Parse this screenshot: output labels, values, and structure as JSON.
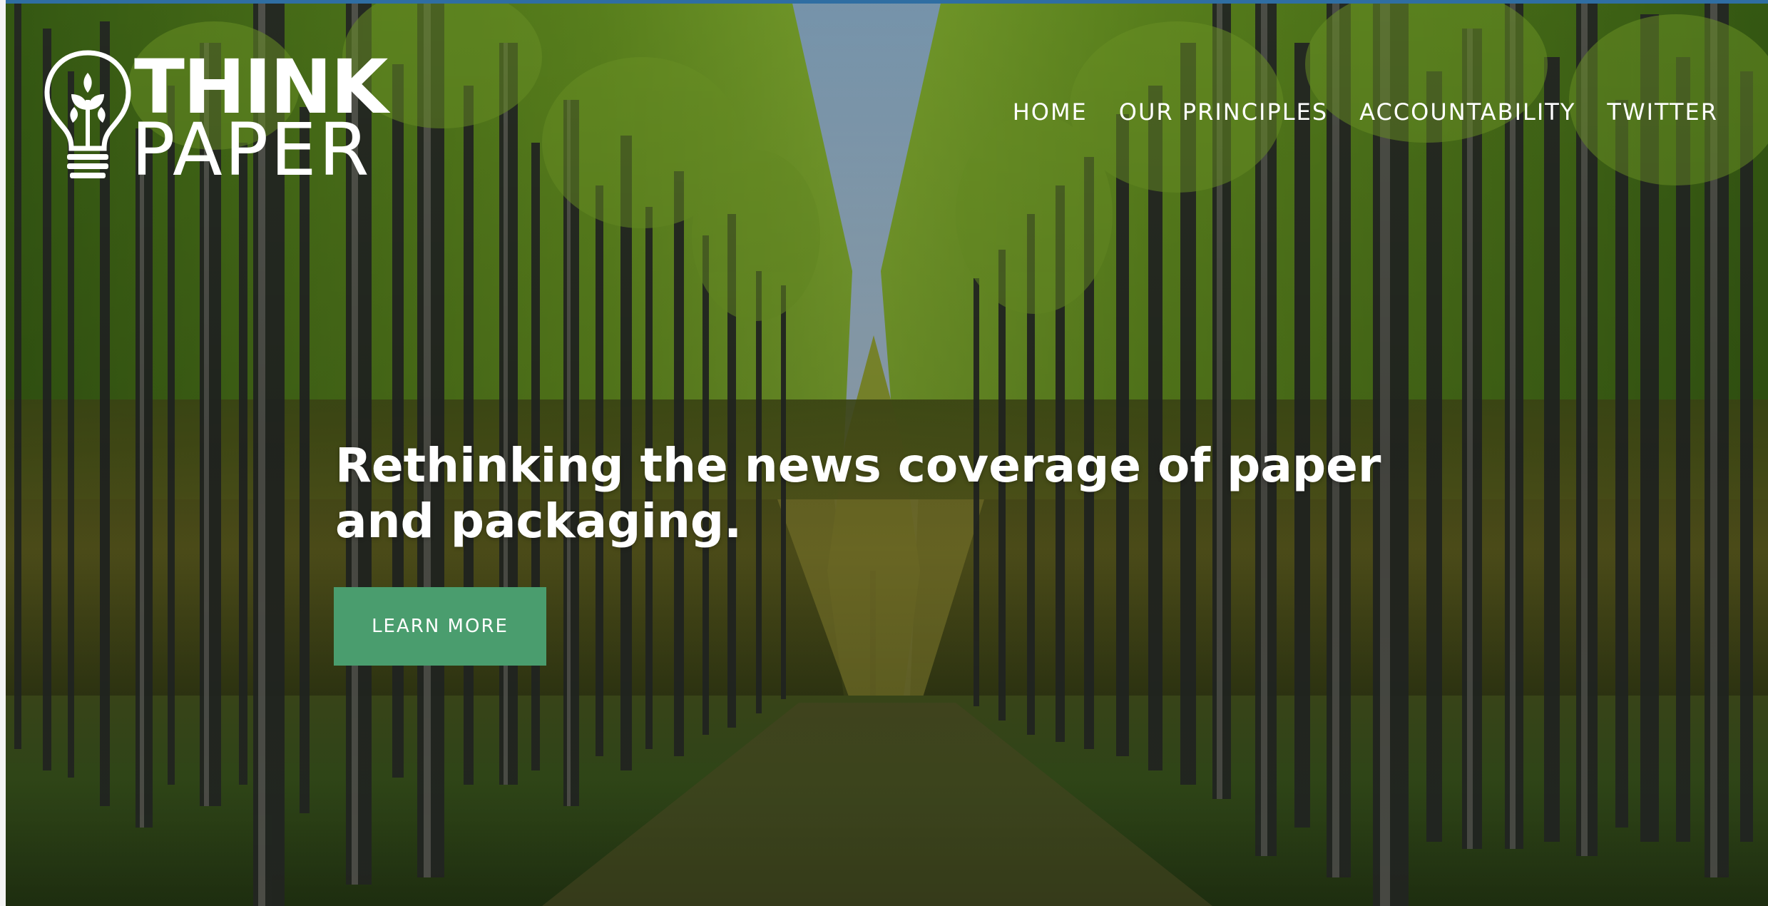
{
  "brand": {
    "logo_line1": "THINK",
    "logo_line2": "PAPER"
  },
  "nav": {
    "items": [
      {
        "label": "HOME"
      },
      {
        "label": "OUR PRINCIPLES"
      },
      {
        "label": "ACCOUNTABILITY"
      },
      {
        "label": "TWITTER"
      }
    ]
  },
  "hero": {
    "headline_line1": "Rethinking the news coverage of paper",
    "headline_line2": "and packaging.",
    "cta_label": "LEARN MORE",
    "background_icon": "forest-image"
  },
  "colors": {
    "cta_background": "#4a9d6e",
    "text": "#ffffff",
    "top_strip": "#2f6ea2"
  }
}
